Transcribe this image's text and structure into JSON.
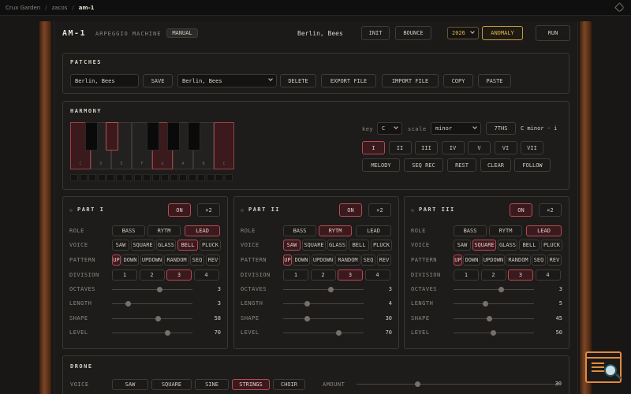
{
  "breadcrumb": [
    "Crux Garden",
    "zacos",
    "am-1"
  ],
  "header": {
    "title": "AM-1",
    "subtitle": "ARPEGGIO MACHINE",
    "manual": "MANUAL",
    "preset_name": "Berlin, Bees",
    "init": "INIT",
    "bounce": "BOUNCE",
    "year": "2026",
    "anomaly": "ANOMALY",
    "run": "RUN"
  },
  "patches": {
    "title": "PATCHES",
    "name_value": "Berlin, Bees",
    "save": "SAVE",
    "selected": "Berlin, Bees",
    "delete": "DELETE",
    "export": "EXPORT FILE",
    "import": "IMPORT FILE",
    "copy": "COPY",
    "paste": "PASTE"
  },
  "harmony": {
    "title": "HARMONY",
    "key_label": "key",
    "key": "C",
    "scale_label": "scale",
    "scale": "minor",
    "chord_type": "7THS",
    "chord_readout": "C minor · i",
    "degrees": [
      "I",
      "II",
      "III",
      "IV",
      "V",
      "VI",
      "VII"
    ],
    "actions": [
      "MELODY",
      "SEQ REC",
      "REST",
      "CLEAR",
      "FOLLOW"
    ],
    "note_labels": [
      "C",
      "D",
      "E",
      "F",
      "G",
      "A",
      "B",
      "C"
    ]
  },
  "parts": [
    {
      "title": "PART I",
      "on": "ON",
      "mult": "×2",
      "roles": [
        "BASS",
        "RYTM",
        "LEAD"
      ],
      "role_active": 2,
      "voices": [
        "SAW",
        "SQUARE",
        "GLASS",
        "BELL",
        "PLUCK"
      ],
      "voice_active": 3,
      "patterns": [
        "UP",
        "DOWN",
        "UPDOWN",
        "RANDOM",
        "SEQ",
        "REV"
      ],
      "pattern_active": 0,
      "divisions": [
        "1",
        "2",
        "3",
        "4"
      ],
      "division_active": 2,
      "octaves": "3",
      "length": "3",
      "shape": "58",
      "level": "70",
      "octaves_f": 0.6,
      "length_f": 0.2,
      "shape_f": 0.58,
      "level_f": 0.7
    },
    {
      "title": "PART II",
      "on": "ON",
      "mult": "×2",
      "roles": [
        "BASS",
        "RYTM",
        "LEAD"
      ],
      "role_active": 1,
      "voices": [
        "SAW",
        "SQUARE",
        "GLASS",
        "BELL",
        "PLUCK"
      ],
      "voice_active": 0,
      "patterns": [
        "UP",
        "DOWN",
        "UPDOWN",
        "RANDOM",
        "SEQ",
        "REV"
      ],
      "pattern_active": 0,
      "divisions": [
        "1",
        "2",
        "3",
        "4"
      ],
      "division_active": 2,
      "octaves": "3",
      "length": "4",
      "shape": "30",
      "level": "70",
      "octaves_f": 0.6,
      "length_f": 0.3,
      "shape_f": 0.3,
      "level_f": 0.7
    },
    {
      "title": "PART III",
      "on": "ON",
      "mult": "×2",
      "roles": [
        "BASS",
        "RYTM",
        "LEAD"
      ],
      "role_active": 2,
      "voices": [
        "SAW",
        "SQUARE",
        "GLASS",
        "BELL",
        "PLUCK"
      ],
      "voice_active": 1,
      "patterns": [
        "UP",
        "DOWN",
        "UPDOWN",
        "RANDOM",
        "SEQ",
        "REV"
      ],
      "pattern_active": 0,
      "divisions": [
        "1",
        "2",
        "3",
        "4"
      ],
      "division_active": 2,
      "octaves": "3",
      "length": "5",
      "shape": "45",
      "level": "50",
      "octaves_f": 0.6,
      "length_f": 0.4,
      "shape_f": 0.45,
      "level_f": 0.5
    }
  ],
  "part_labels": {
    "role": "ROLE",
    "voice": "VOICE",
    "pattern": "PATTERN",
    "division": "DIVISION",
    "octaves": "OCTAVES",
    "length": "LENGTH",
    "shape": "SHAPE",
    "level": "LEVEL"
  },
  "drone": {
    "title": "DRONE",
    "voice_label": "VOICE",
    "voices": [
      "SAW",
      "SQUARE",
      "SINE",
      "STRINGS",
      "CHOIR"
    ],
    "voice_active": 3,
    "amount_label": "AMOUNT",
    "amount": "30",
    "amount_f": 0.3
  },
  "colors": {
    "accent": "#b64a54",
    "amber": "#e6b44a"
  }
}
